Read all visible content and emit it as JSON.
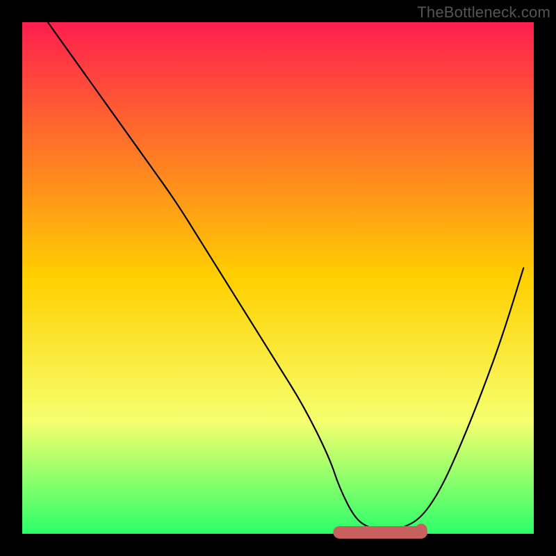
{
  "watermark": "TheBottleneck.com",
  "colors": {
    "bg_black": "#000000",
    "grad_top": "#ff1e4e",
    "grad_mid": "#ffd000",
    "grad_low": "#f6ff6e",
    "grad_bottom": "#2bff6a",
    "curve": "#000000",
    "marker_fill": "#c96060"
  },
  "chart_data": {
    "type": "line",
    "title": "",
    "xlabel": "",
    "ylabel": "",
    "xlim": [
      0,
      100
    ],
    "ylim": [
      0,
      100
    ],
    "x": [
      5,
      10,
      15,
      20,
      25,
      30,
      35,
      40,
      45,
      50,
      55,
      60,
      62,
      65,
      68,
      72,
      74,
      78,
      82,
      86,
      90,
      94,
      98
    ],
    "values": [
      100,
      93,
      86,
      79,
      72,
      65,
      57,
      49,
      41,
      33,
      25,
      15,
      9,
      3,
      1,
      0.5,
      1,
      3,
      9,
      18,
      28,
      39,
      52
    ],
    "annotations": [
      {
        "shape": "marker_band",
        "x_from": 62,
        "x_to": 78,
        "y": 1.5
      }
    ]
  }
}
